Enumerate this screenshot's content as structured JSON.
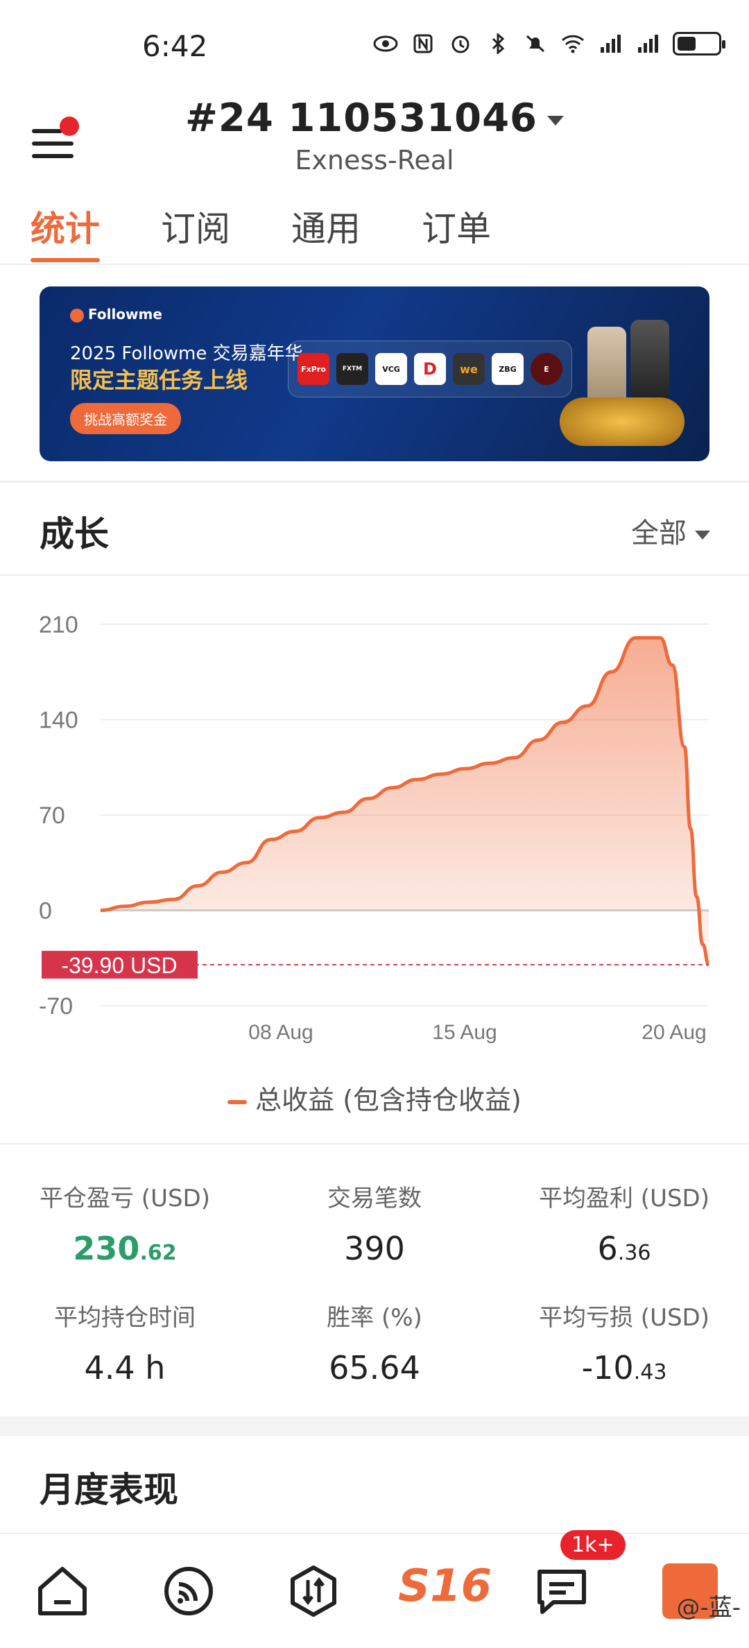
{
  "status_bar": {
    "time": "6:42"
  },
  "header": {
    "account_number": "#24  110531046",
    "server": "Exness-Real"
  },
  "tabs": [
    {
      "label": "统计",
      "active": true
    },
    {
      "label": "订阅",
      "active": false
    },
    {
      "label": "通用",
      "active": false
    },
    {
      "label": "订单",
      "active": false
    }
  ],
  "banner": {
    "brand": "Followme",
    "line1": "2025 Followme 交易嘉年华",
    "line2": "限定主题任务上线",
    "cta": "挑战高额奖金",
    "partner_logos": [
      "FxPro",
      "FXTM",
      "VCG",
      "D",
      "we",
      "ZBG",
      "E"
    ]
  },
  "growth": {
    "title": "成长",
    "filter": "全部",
    "marker_label": "-39.90 USD",
    "legend": "总收益 (包含持仓收益)"
  },
  "chart_data": {
    "type": "area",
    "y_ticks": [
      210,
      140,
      70,
      0,
      -70
    ],
    "ylim": [
      -70,
      210
    ],
    "x_tick_labels": [
      "08 Aug",
      "15 Aug",
      "20 Aug"
    ],
    "x": [
      0,
      4,
      8,
      12,
      16,
      20,
      24,
      28,
      32,
      36,
      40,
      44,
      48,
      52,
      56,
      60,
      64,
      68,
      72,
      76,
      80,
      84,
      88,
      92,
      94,
      96,
      97,
      98,
      99,
      100
    ],
    "values": [
      0,
      3,
      6,
      8,
      18,
      28,
      35,
      52,
      58,
      68,
      72,
      82,
      90,
      96,
      100,
      104,
      108,
      112,
      125,
      138,
      150,
      175,
      200,
      200,
      180,
      120,
      60,
      10,
      -25,
      -39.9
    ],
    "series_color": "#ef6a3a",
    "marker_value": -39.9
  },
  "stats": [
    {
      "label": "平仓盈亏 (USD)",
      "int": "230",
      "dec": ".62",
      "green": true
    },
    {
      "label": "交易笔数",
      "int": "390",
      "dec": "",
      "green": false
    },
    {
      "label": "平均盈利 (USD)",
      "int": "6",
      "dec": ".36",
      "green": false
    },
    {
      "label": "平均持仓时间",
      "int": "4.4 h",
      "dec": "",
      "green": false
    },
    {
      "label": "胜率 (%)",
      "int": "65.64",
      "dec": "",
      "green": false
    },
    {
      "label": "平均亏损 (USD)",
      "int": "-10",
      "dec": ".43",
      "green": false
    }
  ],
  "monthly": {
    "title": "月度表现"
  },
  "bottom_nav": {
    "brand": "S16",
    "badge": "1k+",
    "watermark": "@-蓝-"
  }
}
